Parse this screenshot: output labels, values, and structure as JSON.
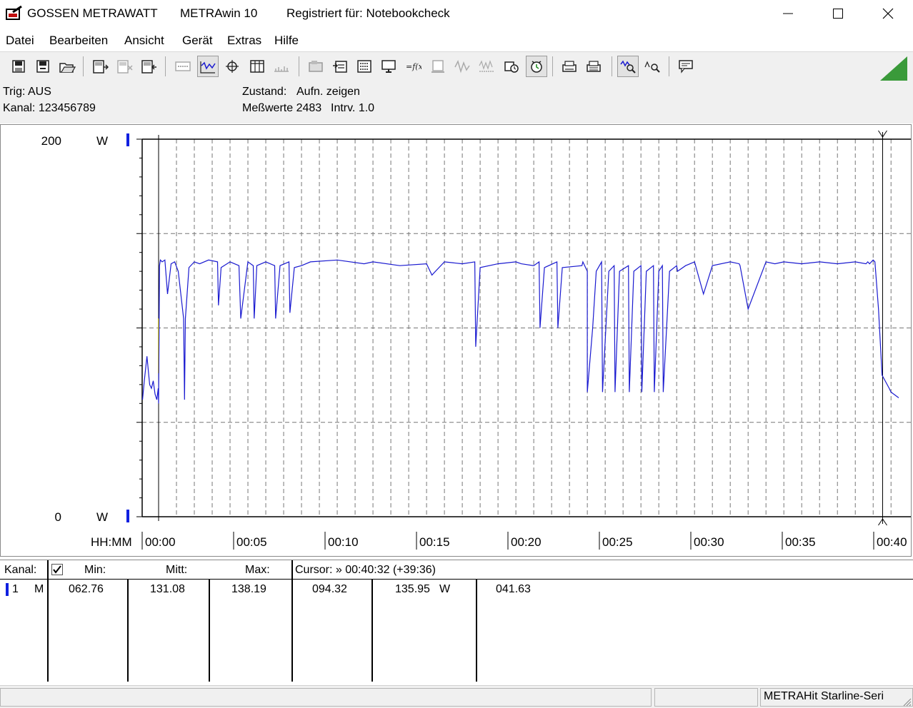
{
  "titlebar": {
    "vendor": "GOSSEN METRAWATT",
    "app": "METRAwin 10",
    "registered": "Registriert für: Notebookcheck"
  },
  "menu": [
    "Datei",
    "Bearbeiten",
    "Ansicht",
    "Gerät",
    "Extras",
    "Hilfe"
  ],
  "toolbar": {
    "icons": [
      "save-icon",
      "save-as-icon",
      "open-folder-icon",
      "device-read-icon",
      "device-delete-icon",
      "device-write-icon",
      "numeric-display-icon",
      "curve-icon",
      "crosshair-icon",
      "table-icon",
      "scope-icon",
      "device-settings-icon",
      "transfer-icon",
      "statistics-icon",
      "monitor-icon",
      "function-icon",
      "memory-icon",
      "waveform-icon",
      "multi-waveform-icon",
      "timer-icon",
      "clock-icon",
      "printer-icon",
      "print-icon",
      "zoom-curve-icon",
      "zoom-icon",
      "comment-icon"
    ]
  },
  "info": {
    "trig": "Trig: AUS",
    "kanal": "Kanal: 123456789",
    "zustand_label": "Zustand:",
    "zustand_value": "Aufn. zeigen",
    "messwerte": "Meßwerte 2483",
    "intrv": "Intrv. 1.0"
  },
  "chart_data": {
    "type": "line",
    "title": "",
    "xlabel": "HH:MM",
    "ylabel": "",
    "y_top_label": "200",
    "y_bottom_label": "0",
    "y_unit": "W",
    "ylim": [
      0,
      200
    ],
    "xlim_minutes": [
      0,
      41.43
    ],
    "x_tick_labels": [
      "00:00",
      "00:05",
      "00:10",
      "00:15",
      "00:20",
      "00:25",
      "00:30",
      "00:35",
      "00:40"
    ],
    "grid": true,
    "series_color": "#1a1ad0",
    "series": [
      {
        "x_minutes": [
          -0.9,
          -0.8,
          -0.65,
          -0.5,
          -0.4,
          -0.3,
          -0.2,
          -0.1,
          -0.02,
          0.0,
          0.05,
          0.1,
          0.2,
          0.35,
          0.5,
          0.7,
          0.9,
          1.1,
          1.4,
          1.45,
          1.5,
          1.7,
          2.0,
          2.3,
          2.8,
          3.3,
          3.35,
          3.5,
          4.0,
          4.5,
          4.6,
          5.0,
          5.3,
          5.35,
          5.5,
          6.0,
          6.5,
          6.55,
          6.8,
          7.3,
          7.35,
          7.6,
          8.0,
          8.5,
          10,
          11.5,
          12,
          13.5,
          15,
          15.3,
          16,
          17,
          17.7,
          17.75,
          18,
          19,
          20,
          20.3,
          21,
          21.3,
          21.35,
          21.6,
          22.3,
          22.35,
          22.6,
          23.7,
          23.75,
          24,
          24.0,
          24.3,
          24.5,
          24.8,
          24.85,
          25.2,
          25.5,
          25.55,
          25.8,
          26.3,
          26.35,
          26.6,
          27.0,
          27.05,
          27.3,
          27.7,
          27.75,
          28.0,
          28.2,
          28.25,
          28.6,
          29.0,
          29.05,
          29.5,
          30,
          30.5,
          31,
          32,
          32.5,
          32.55,
          33,
          34,
          34.5,
          35,
          36,
          37,
          38,
          39,
          39.6,
          39.7,
          39.8,
          40.0,
          40.1,
          40.3,
          40.5,
          40.9,
          41.0,
          41.43
        ],
        "y_watts": [
          62,
          72,
          85,
          70,
          68,
          72,
          65,
          62,
          68,
          60,
          133,
          136,
          135,
          136,
          118,
          134,
          135,
          130,
          105,
          62,
          105,
          132,
          135,
          134,
          136,
          135,
          112,
          132,
          135,
          133,
          105,
          135,
          133,
          105,
          133,
          135,
          133,
          105,
          133,
          135,
          108,
          132,
          133,
          135,
          136,
          134,
          135,
          133,
          134,
          128,
          135,
          134,
          135,
          90,
          132,
          134,
          135,
          134,
          133,
          135,
          100,
          132,
          135,
          100,
          132,
          133,
          135,
          130,
          66,
          100,
          130,
          135,
          66,
          130,
          133,
          66,
          130,
          133,
          66,
          130,
          133,
          66,
          130,
          133,
          66,
          130,
          133,
          66,
          130,
          133,
          130,
          133,
          135,
          118,
          133,
          135,
          134,
          133,
          110,
          135,
          134,
          135,
          134,
          135,
          134,
          135,
          134,
          135,
          134,
          136,
          135,
          110,
          75,
          68,
          66,
          63
        ]
      }
    ],
    "cursor_minutes": 40.53,
    "marker_minutes": 0.0
  },
  "table": {
    "headers": {
      "kanal": "Kanal:",
      "min": "Min:",
      "mitt": "Mitt:",
      "max": "Max:",
      "cursor": "Cursor: » 00:40:32 (+39:36)"
    },
    "row": {
      "channel": "1",
      "mode": "M",
      "min": "062.76",
      "mitt": "131.08",
      "max": "138.19",
      "cursor_val": "094.32",
      "cursor_val2": "135.95",
      "unit": "W",
      "cursor_diff": "041.63"
    }
  },
  "statusbar": {
    "device": "METRAHit Starline-Seri"
  },
  "colors": {
    "series": "#1a1ad0",
    "marker": "#f0e000",
    "channel_bar": "#1020e0",
    "toolbar_bg": "#f0f0f0"
  }
}
